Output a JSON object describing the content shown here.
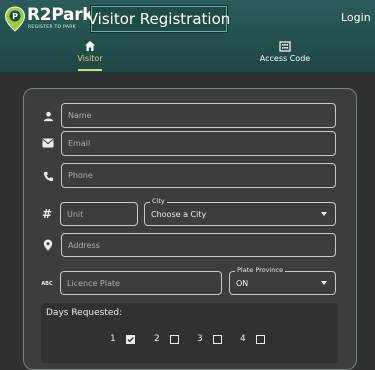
{
  "header": {
    "logo_text": "R2Park",
    "logo_tagline": "REGISTER TO PARK",
    "title": "Visitor Registration",
    "login_label": "Login",
    "tabs": [
      {
        "label": "Visitor",
        "icon": "home-icon",
        "active": true
      },
      {
        "label": "Access Code",
        "icon": "building-icon",
        "active": false
      }
    ]
  },
  "colors": {
    "header_bg": "#2a5b5a",
    "accent": "#d9d27a",
    "page_bg": "#2e3133",
    "card_bg": "#3b3e40",
    "field_border": "#c7cacb"
  },
  "form": {
    "name_placeholder": "Name",
    "email_placeholder": "Email",
    "phone_placeholder": "Phone",
    "unit_placeholder": "Unit",
    "city_label": "City",
    "city_value": "Choose a City",
    "address_placeholder": "Address",
    "plate_placeholder": "Licence Plate",
    "plate_province_label": "Plate Province",
    "plate_province_value": "ON",
    "days_label": "Days Requested:",
    "days": [
      {
        "label": "1",
        "checked": true
      },
      {
        "label": "2",
        "checked": false
      },
      {
        "label": "3",
        "checked": false
      },
      {
        "label": "4",
        "checked": false
      }
    ]
  }
}
